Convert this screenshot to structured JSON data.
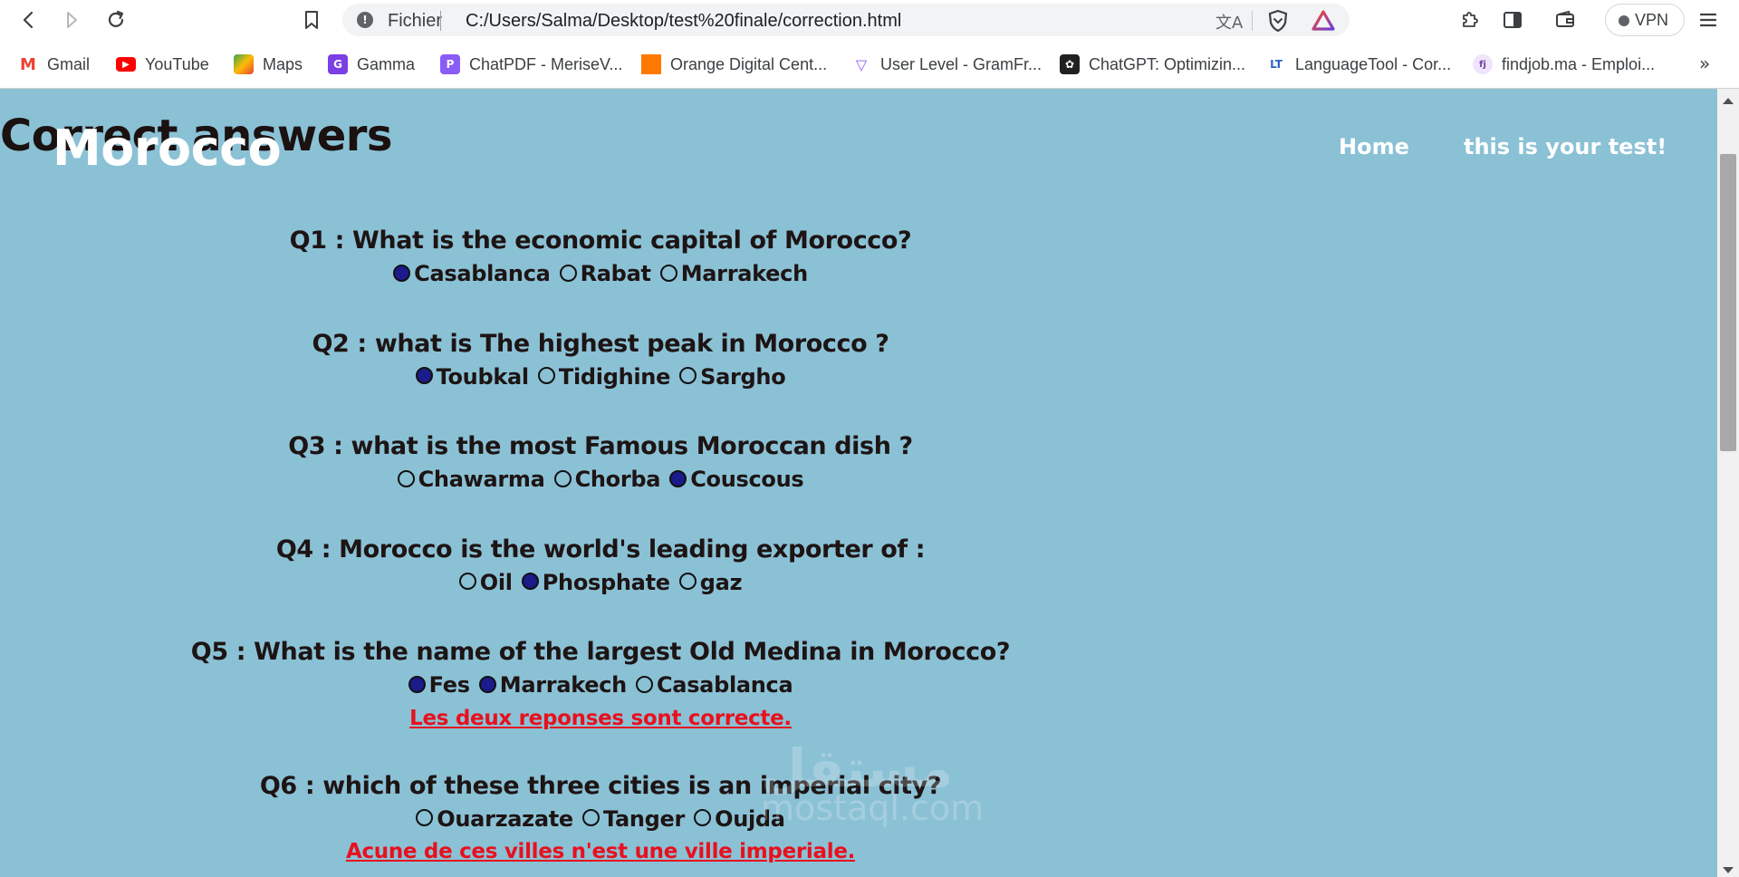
{
  "browser": {
    "url_scheme": "Fichier",
    "url": "C:/Users/Salma/Desktop/test%20finale/correction.html",
    "vpn_label": "VPN",
    "bookmarks": [
      {
        "label": "Gmail",
        "icon": "gmail-icon",
        "color": "#ea4335",
        "glyph": "M"
      },
      {
        "label": "YouTube",
        "icon": "youtube-icon",
        "color": "#ff0000",
        "glyph": "▶"
      },
      {
        "label": "Maps",
        "icon": "maps-icon",
        "color": "#34a853",
        "glyph": "◆"
      },
      {
        "label": "Gamma",
        "icon": "gamma-icon",
        "color": "#7b3fe4",
        "glyph": "G"
      },
      {
        "label": "ChatPDF - MeriseV...",
        "icon": "chatpdf-icon",
        "color": "#8a5cf6",
        "glyph": "P"
      },
      {
        "label": "Orange Digital Cent...",
        "icon": "orange-icon",
        "color": "#ff7900",
        "glyph": ""
      },
      {
        "label": "User Level - GramFr...",
        "icon": "gramfr-icon",
        "color": "#8b5cf6",
        "glyph": "▽"
      },
      {
        "label": "ChatGPT: Optimizin...",
        "icon": "chatgpt-icon",
        "color": "#202123",
        "glyph": "✿"
      },
      {
        "label": "LanguageTool - Cor...",
        "icon": "languagetool-icon",
        "color": "#2a64c4",
        "glyph": "LT"
      },
      {
        "label": "findjob.ma - Emploi...",
        "icon": "findjob-icon",
        "color": "#b38ad8",
        "glyph": "fj"
      }
    ]
  },
  "page": {
    "heading": "Correct answers",
    "brand": "Morocco",
    "nav": {
      "home": "Home",
      "test": "this is your test!"
    }
  },
  "questions": [
    {
      "text": "Q1 : What is the economic capital of Morocco?",
      "options": [
        {
          "label": "Casablanca",
          "selected": true
        },
        {
          "label": "Rabat",
          "selected": false
        },
        {
          "label": "Marrakech",
          "selected": false
        }
      ],
      "note": ""
    },
    {
      "text": "Q2 : what is The highest peak in Morocco ?",
      "options": [
        {
          "label": "Toubkal",
          "selected": true
        },
        {
          "label": "Tidighine",
          "selected": false
        },
        {
          "label": "Sargho",
          "selected": false
        }
      ],
      "note": ""
    },
    {
      "text": "Q3 : what is the most Famous Moroccan dish ?",
      "options": [
        {
          "label": "Chawarma",
          "selected": false
        },
        {
          "label": "Chorba",
          "selected": false
        },
        {
          "label": "Couscous",
          "selected": true
        }
      ],
      "note": ""
    },
    {
      "text": "Q4 : Morocco is the world's leading exporter of :",
      "options": [
        {
          "label": "Oil",
          "selected": false
        },
        {
          "label": "Phosphate",
          "selected": true
        },
        {
          "label": "gaz",
          "selected": false
        }
      ],
      "note": ""
    },
    {
      "text": "Q5 : What is the name of the largest Old Medina in Morocco?",
      "options": [
        {
          "label": "Fes",
          "selected": true
        },
        {
          "label": "Marrakech",
          "selected": true
        },
        {
          "label": "Casablanca",
          "selected": false
        }
      ],
      "note": "Les deux reponses sont correcte."
    },
    {
      "text": "Q6 : which of these three cities is an imperial city?",
      "options": [
        {
          "label": "Ouarzazate",
          "selected": false
        },
        {
          "label": "Tanger",
          "selected": false
        },
        {
          "label": "Oujda",
          "selected": false
        }
      ],
      "note": "Acune de ces villes n'est une ville imperiale."
    }
  ],
  "watermark": {
    "arabic": "مستقل",
    "latin": "mostaql.com"
  },
  "colors": {
    "page_bg": "#8bc1d5",
    "selected_radio": "#1b1b8c",
    "note": "#e8101e"
  }
}
